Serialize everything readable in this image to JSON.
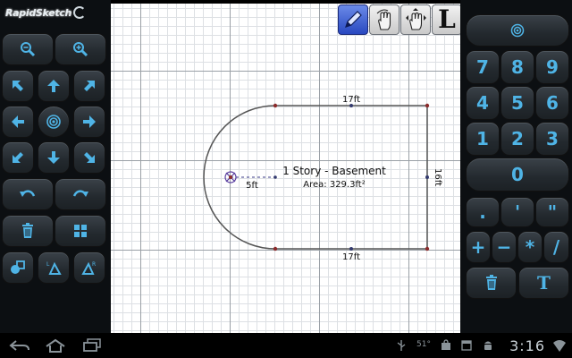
{
  "app": {
    "logo_text": "RapidSketch"
  },
  "drawing": {
    "room_title": "1 Story - Basement",
    "room_area": "Area: 329.3ft²",
    "top_dimension": "17ft",
    "bottom_dimension": "17ft",
    "right_dimension": "16ft",
    "radius_dimension": "5ft"
  },
  "tools": [
    {
      "name": "pen-tool",
      "active": true
    },
    {
      "name": "pan-tool",
      "active": false
    },
    {
      "name": "move-tool",
      "active": false
    },
    {
      "name": "line-tool",
      "label": "L",
      "active": false
    }
  ],
  "keypad": {
    "digits": [
      "7",
      "8",
      "9",
      "4",
      "5",
      "6",
      "1",
      "2",
      "3",
      "0"
    ],
    "symbols": [
      ".",
      "'",
      "\"",
      "+",
      "−",
      "*",
      "/"
    ],
    "text_key": "T"
  },
  "status_bar": {
    "clock": "3:16",
    "temp": "51°"
  },
  "colors": {
    "accent": "#4fb4e6",
    "active_tool": "#2f53c9",
    "shape_stroke": "#555555",
    "vertex": "#8b2b2b"
  }
}
